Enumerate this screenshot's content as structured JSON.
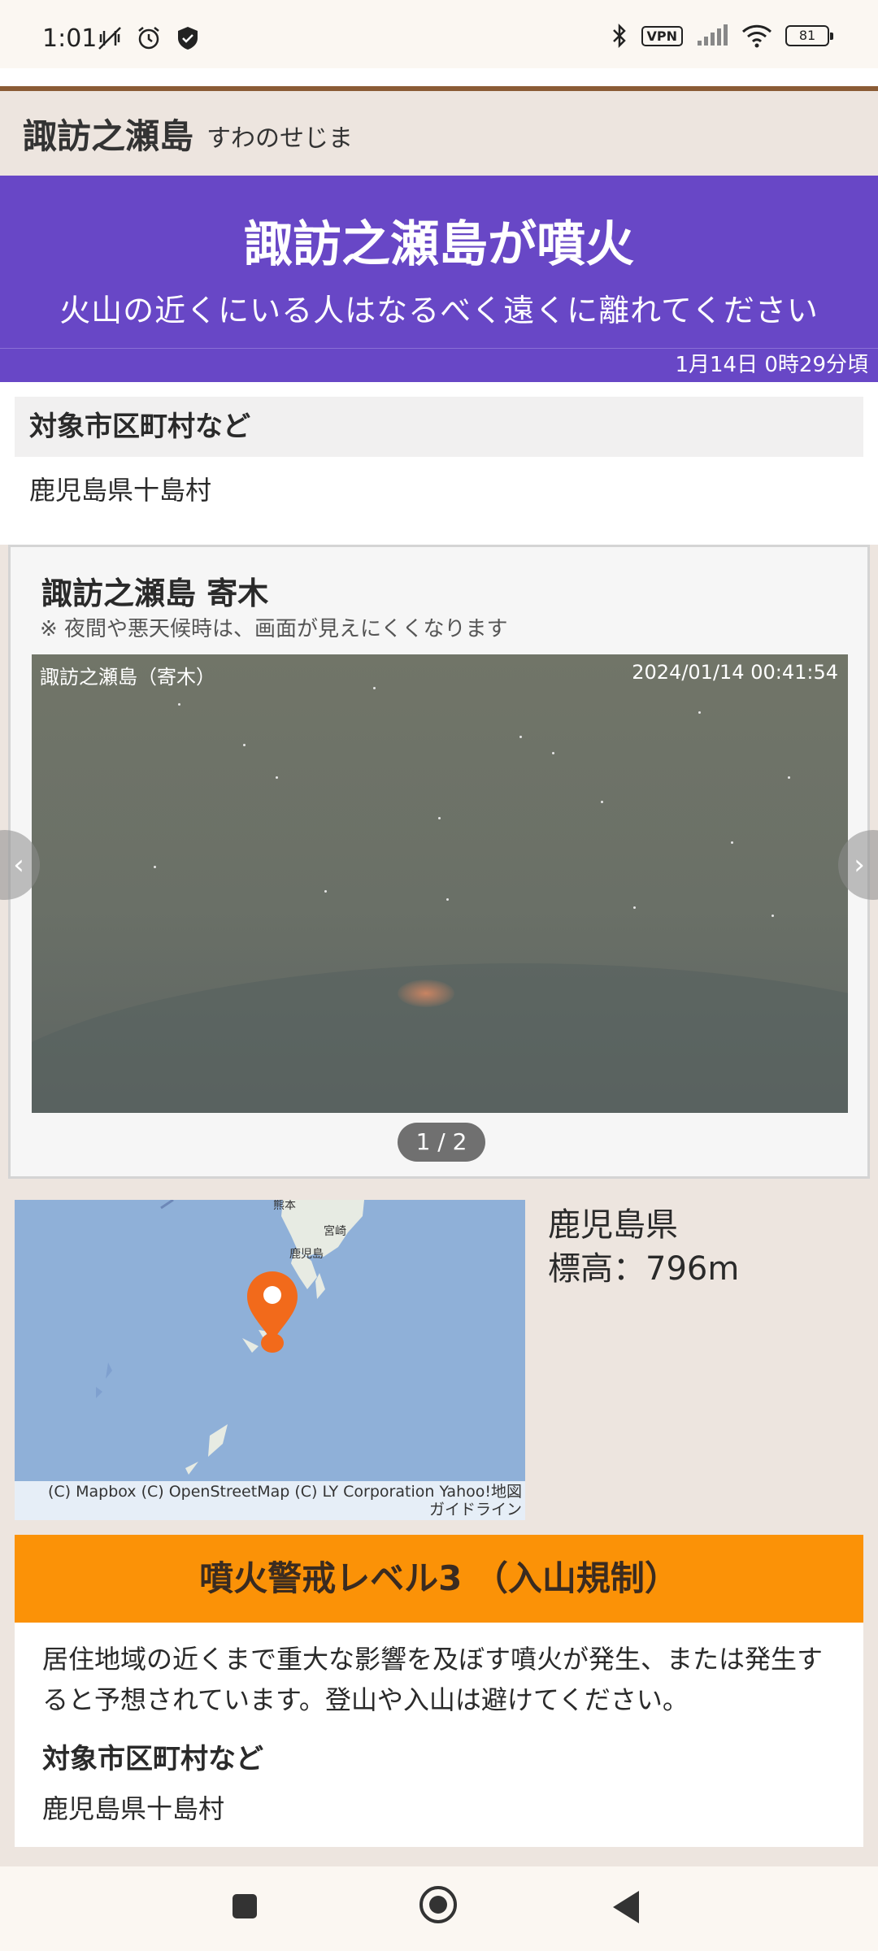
{
  "status_bar": {
    "time": "1:01",
    "vpn": "VPN",
    "battery": "81"
  },
  "header": {
    "title": "諏訪之瀬島",
    "kana": "すわのせじま"
  },
  "alert": {
    "title": "諏訪之瀬島が噴火",
    "subtitle": "火山の近くにいる人はなるべく遠くに離れてください",
    "time": "1月14日 0時29分頃",
    "color": "#6847c6"
  },
  "area": {
    "heading": "対象市区町村など",
    "value": "鹿児島県十島村"
  },
  "camera": {
    "title": "諏訪之瀬島 寄木",
    "note": "※ 夜間や悪天候時は、画面が見えにくくなります",
    "overlay_left": "諏訪之瀬島（寄木）",
    "overlay_right": "2024/01/14 00:41:54",
    "prev_icon": "chevron-left-icon",
    "next_icon": "chevron-right-icon",
    "prev_glyph": "‹",
    "next_glyph": "›",
    "pager": "1 / 2"
  },
  "map": {
    "credit_line1": "(C) Mapbox (C) OpenStreetMap (C) LY Corporation Yahoo!地図",
    "credit_line2": "ガイドライン",
    "town_miyazaki": "宮崎",
    "town_kagoshima": "鹿児島",
    "town_kumamoto": "熊本",
    "marker_color": "#f26a1b",
    "prefecture": "鹿児島県",
    "elevation": "標高：796m"
  },
  "level": {
    "heading": "噴火警戒レベル3 （入山規制）",
    "color": "#fb9207",
    "description": "居住地域の近くまで重大な影響を及ぼす噴火が発生、または発生すると予想されています。登山や入山は避けてください。",
    "area_heading": "対象市区町村など",
    "area_value": "鹿児島県十島村"
  }
}
